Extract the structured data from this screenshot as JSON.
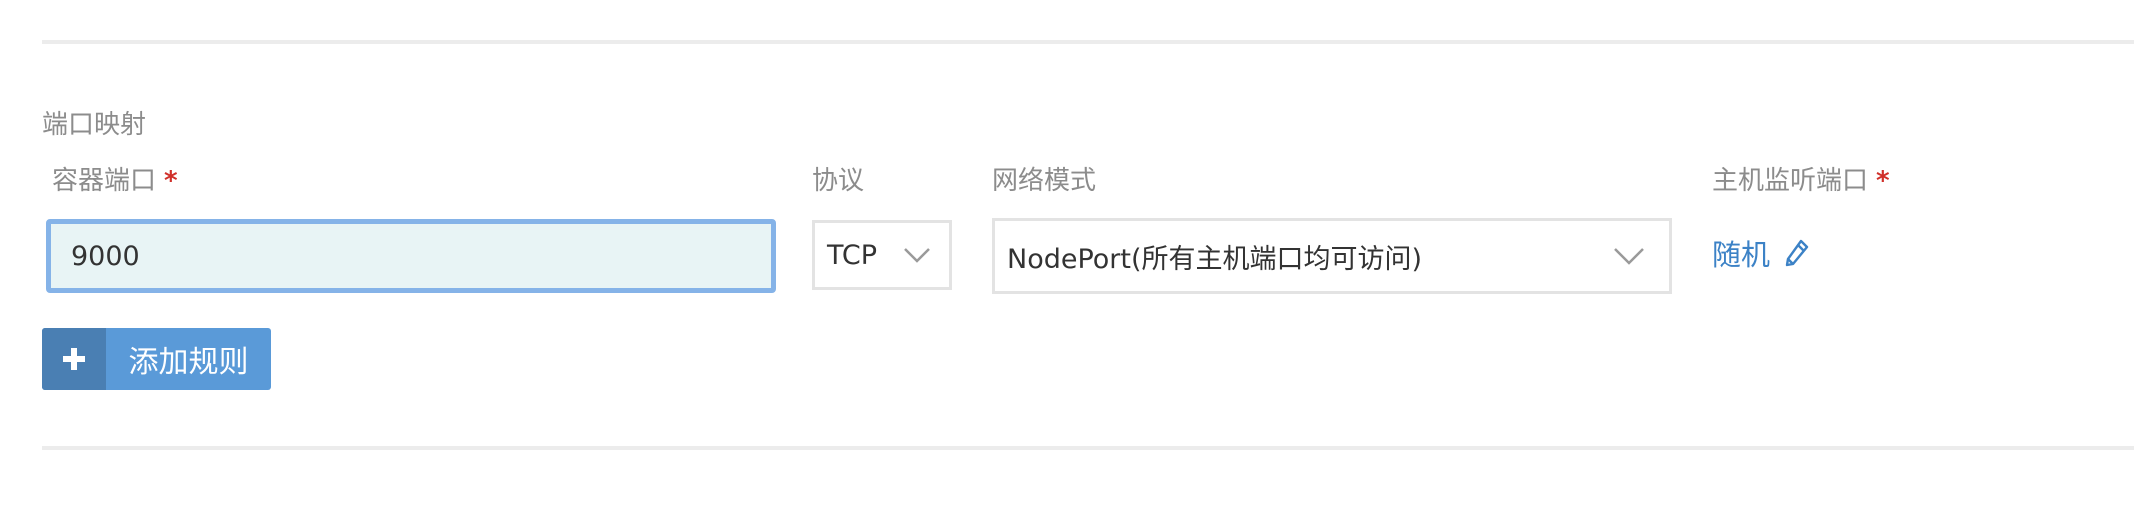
{
  "section": {
    "title": "端口映射"
  },
  "columns": {
    "container_port": "容器端口",
    "protocol": "协议",
    "network_mode": "网络模式",
    "host_port": "主机监听端口",
    "required_mark": "*"
  },
  "rule": {
    "container_port_value": "9000",
    "protocol_value": "TCP",
    "network_mode_value": "NodePort(所有主机端口均可访问)",
    "host_port_value": "随机"
  },
  "buttons": {
    "add_rule": "添加规则"
  },
  "icons": {
    "chevron": "chevron-down-icon",
    "edit": "pencil-icon",
    "add": "plus-icon"
  },
  "colors": {
    "accent": "#5a9ad8",
    "accent_dark": "#4a7fb3",
    "link": "#3c82c6",
    "required": "#d0302a",
    "input_focus_border": "#85b3e8",
    "input_bg": "#e8f4f5"
  }
}
